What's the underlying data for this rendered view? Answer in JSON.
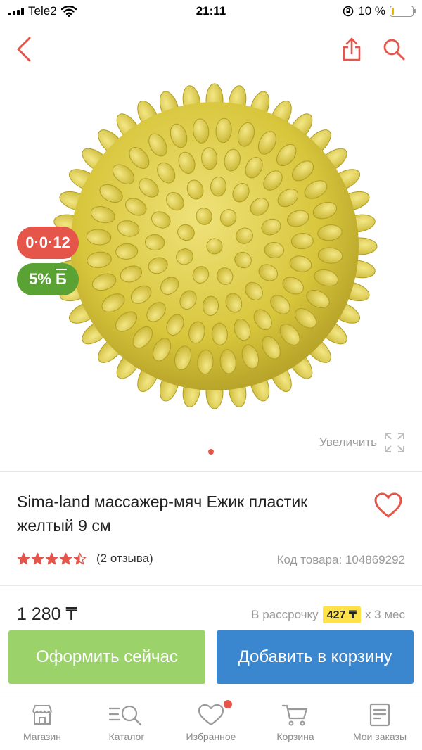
{
  "status_bar": {
    "carrier": "Tele2",
    "time": "21:11",
    "battery_percent": "10 %",
    "battery_level": 0.1
  },
  "nav": {
    "back_icon": "chevron-left-icon",
    "share_icon": "share-icon",
    "search_icon": "search-icon"
  },
  "product_image": {
    "badge_timer": "0·0·12",
    "badge_bonus": "5%",
    "badge_bonus_symbol": "Б",
    "zoom_label": "Увеличить",
    "carousel_count": 1,
    "carousel_active": 1
  },
  "product": {
    "title": "Sima-land массажер-мяч Ежик пластик желтый 9 см",
    "rating": 4.5,
    "reviews_label": "(2 отзыва)",
    "code_label": "Код товара: 104869292",
    "price": "1 280 ₸",
    "installment_prefix": "В рассрочку",
    "installment_amount": "427 ₸",
    "installment_suffix": "х 3 мес"
  },
  "actions": {
    "buy_now": "Оформить сейчас",
    "add_to_cart": "Добавить в корзину"
  },
  "tabbar": {
    "items": [
      {
        "label": "Магазин",
        "icon": "store-icon"
      },
      {
        "label": "Каталог",
        "icon": "catalog-icon"
      },
      {
        "label": "Избранное",
        "icon": "heart-icon"
      },
      {
        "label": "Корзина",
        "icon": "cart-icon"
      },
      {
        "label": "Мои заказы",
        "icon": "orders-icon"
      }
    ]
  },
  "colors": {
    "accent": "#e5554a",
    "bonus": "#5aa233",
    "buy_button": "#9bd36a",
    "cart_button": "#3a86cf",
    "installment_highlight": "#ffe24a"
  }
}
